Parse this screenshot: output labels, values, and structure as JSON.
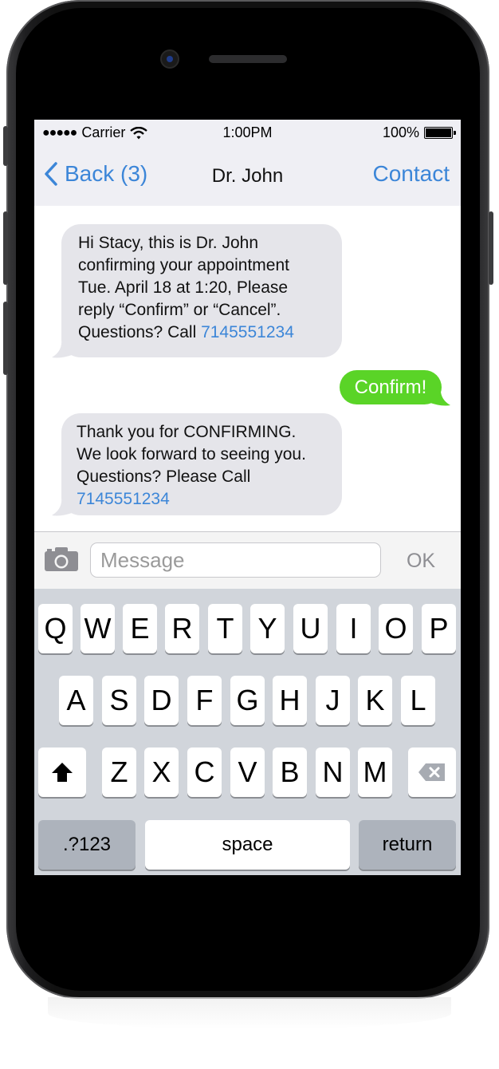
{
  "status": {
    "carrier": "Carrier",
    "time": "1:00PM",
    "battery": "100%"
  },
  "nav": {
    "back_label": "Back (3)",
    "title": "Dr. John",
    "contact_label": "Contact"
  },
  "messages": [
    {
      "direction": "incoming",
      "lines": [
        "Hi Stacy, this is Dr. John",
        "confirming your appointment",
        "Tue. April 18 at 1:20, Please",
        "reply “Confirm” or “Cancel”."
      ],
      "last_prefix": "Questions? Call ",
      "link": "7145551234"
    },
    {
      "direction": "outgoing",
      "text": "Confirm!"
    },
    {
      "direction": "incoming",
      "lines": [
        "Thank you for CONFIRMING.",
        "We look forward to seeing you.",
        "Questions? Please Call"
      ],
      "link": "7145551234"
    }
  ],
  "input": {
    "placeholder": "Message",
    "send_label": "OK"
  },
  "keyboard": {
    "row1": [
      "Q",
      "W",
      "E",
      "R",
      "T",
      "Y",
      "U",
      "I",
      "O",
      "P"
    ],
    "row2": [
      "A",
      "S",
      "D",
      "F",
      "G",
      "H",
      "J",
      "K",
      "L"
    ],
    "row3": [
      "Z",
      "X",
      "C",
      "V",
      "B",
      "N",
      "M"
    ],
    "numbers_label": ".?123",
    "space_label": "space",
    "return_label": "return"
  },
  "colors": {
    "accent": "#3c86d8",
    "outgoing_bubble": "#5ad427",
    "incoming_bubble": "#e5e5ea"
  }
}
